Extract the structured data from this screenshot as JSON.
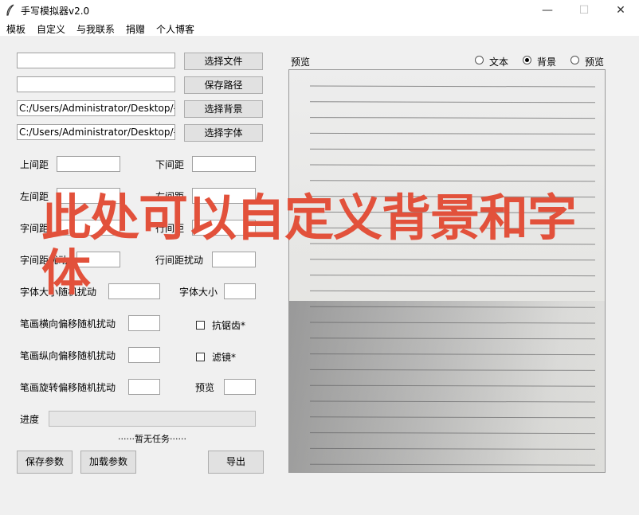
{
  "window": {
    "title": "手写模拟器v2.0",
    "min": "—",
    "max": "☐",
    "close": "✕"
  },
  "menu": [
    "模板",
    "自定义",
    "与我联系",
    "捐赠",
    "个人博客"
  ],
  "files": {
    "text_file": "",
    "save_path": "",
    "background_path": "C:/Users/Administrator/Desktop/手",
    "font_path": "C:/Users/Administrator/Desktop/手",
    "btn_select_file": "选择文件",
    "btn_save_path": "保存路径",
    "btn_select_bg": "选择背景",
    "btn_select_font": "选择字体"
  },
  "params": {
    "top_margin": "上间距",
    "bottom_margin": "下间距",
    "left_margin": "左间距",
    "right_margin": "右间距",
    "char_spacing": "字间距",
    "line_spacing": "行间距",
    "char_jitter": "字间距扰动",
    "line_jitter": "行间距扰动",
    "size_jitter": "字体大小随机扰动",
    "font_size": "字体大小",
    "stroke_h": "笔画横向偏移随机扰动",
    "stroke_v": "笔画纵向偏移随机扰动",
    "stroke_rot": "笔画旋转偏移随机扰动",
    "antialias": "抗锯齿*",
    "filter": "滤镜*",
    "preview": "预览"
  },
  "progress": {
    "label": "进度",
    "value": 0,
    "status": "······暂无任务······"
  },
  "actions": {
    "save_params": "保存参数",
    "load_params": "加载参数",
    "export": "导出"
  },
  "preview_panel": {
    "title": "预览",
    "modes": [
      {
        "label": "文本",
        "selected": false
      },
      {
        "label": "背景",
        "selected": true
      },
      {
        "label": "预览",
        "selected": false
      }
    ]
  },
  "overlay": {
    "line1": "此处可以自定义背景和字",
    "line2": "体",
    "color": "#e2513b"
  }
}
